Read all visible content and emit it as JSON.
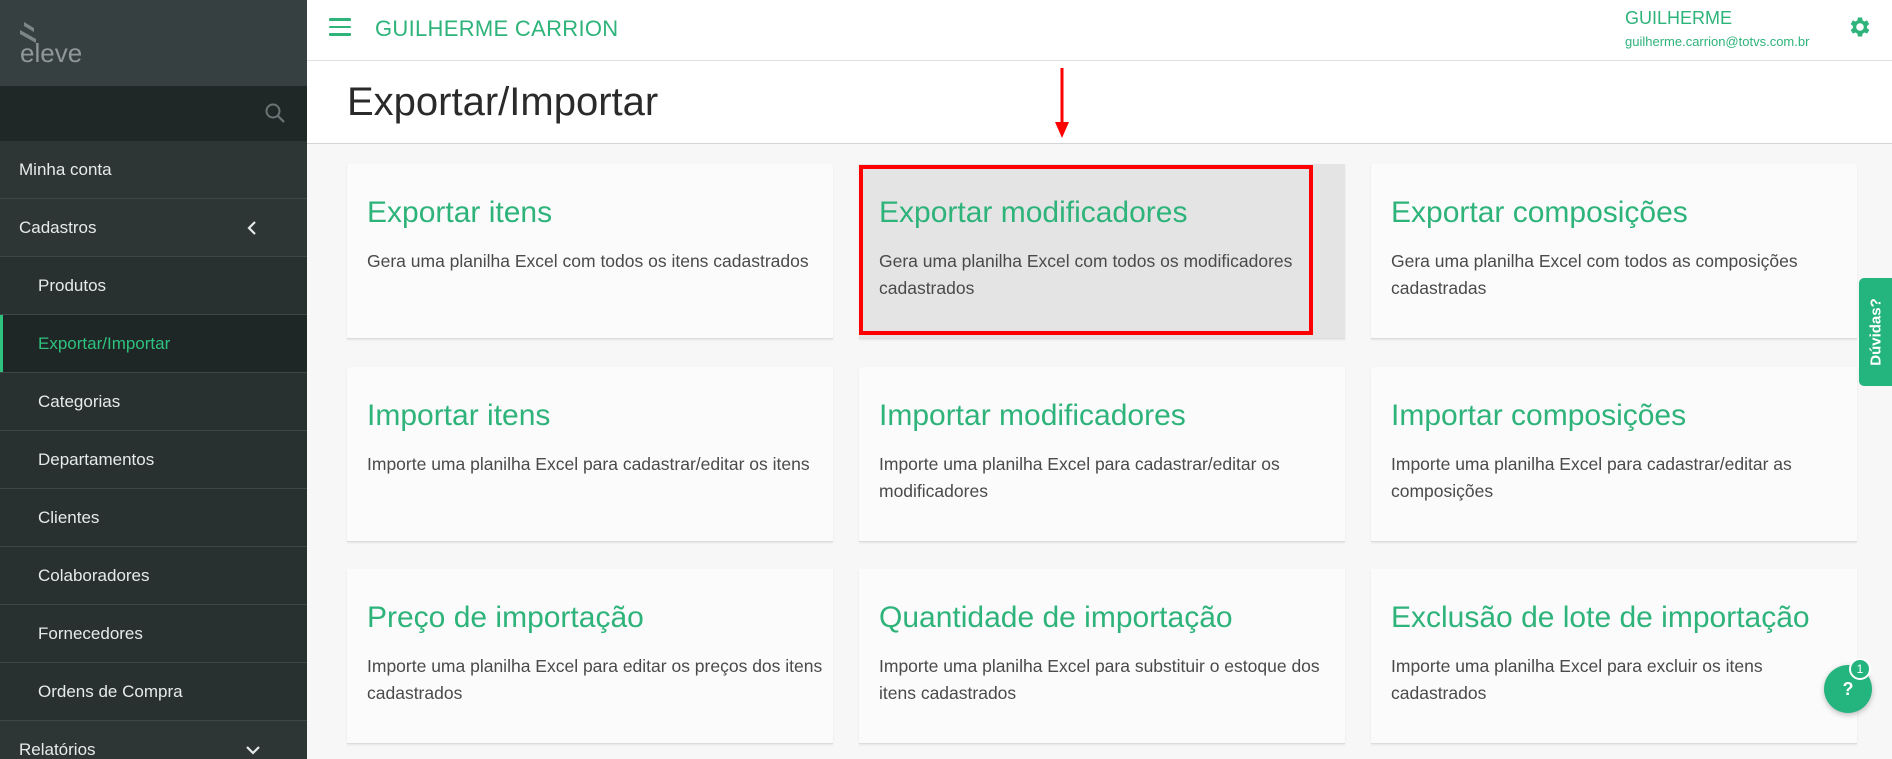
{
  "app": {
    "logo_text": "eleve",
    "header_title": "GUILHERME CARRION",
    "user_name": "GUILHERME",
    "user_email": "guilherme.carrion@totvs.com.br"
  },
  "sidebar": {
    "search_placeholder": "",
    "items": [
      {
        "label": "Minha conta",
        "level": "top"
      },
      {
        "label": "Cadastros",
        "level": "top",
        "expanded": true
      },
      {
        "label": "Produtos",
        "level": "sub"
      },
      {
        "label": "Exportar/Importar",
        "level": "sub",
        "active": true
      },
      {
        "label": "Categorias",
        "level": "sub"
      },
      {
        "label": "Departamentos",
        "level": "sub"
      },
      {
        "label": "Clientes",
        "level": "sub"
      },
      {
        "label": "Colaboradores",
        "level": "sub"
      },
      {
        "label": "Fornecedores",
        "level": "sub"
      },
      {
        "label": "Ordens de Compra",
        "level": "sub"
      },
      {
        "label": "Relatórios",
        "level": "top",
        "expanded": false
      }
    ]
  },
  "page": {
    "title": "Exportar/Importar"
  },
  "cards": [
    {
      "title": "Exportar itens",
      "desc": "Gera uma planilha Excel com todos os itens cadastrados"
    },
    {
      "title": "Exportar modificadores",
      "desc": "Gera uma planilha Excel com todos os modificadores cadastrados",
      "hover": true
    },
    {
      "title": "Exportar composições",
      "desc": "Gera uma planilha Excel com todos as composições cadastradas"
    },
    {
      "title": "Importar itens",
      "desc": "Importe uma planilha Excel para cadastrar/editar os itens"
    },
    {
      "title": "Importar modificadores",
      "desc": "Importe uma planilha Excel para cadastrar/editar os modificadores"
    },
    {
      "title": "Importar composições",
      "desc": "Importe uma planilha Excel para cadastrar/editar as composições"
    },
    {
      "title": "Preço de importação",
      "desc": "Importe uma planilha Excel para editar os preços dos itens cadastrados"
    },
    {
      "title": "Quantidade de importação",
      "desc": "Importe uma planilha Excel para substituir o estoque dos itens cadastrados"
    },
    {
      "title": "Exclusão de lote de importação",
      "desc": "Importe uma planilha Excel para excluir os itens cadastrados"
    }
  ],
  "side_tab": {
    "label": "Dúvidas?"
  },
  "help": {
    "label": "?",
    "badge": "1"
  },
  "colors": {
    "accent": "#2eb37a",
    "sidebar_bg": "#2e3535",
    "highlight": "#ff0000"
  }
}
